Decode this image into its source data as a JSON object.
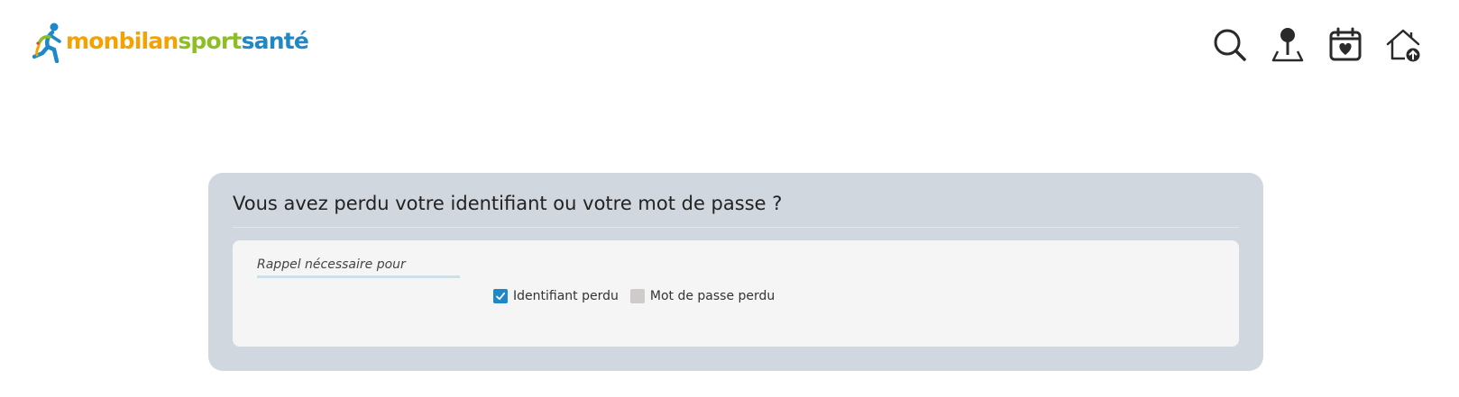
{
  "header": {
    "logo": {
      "part1": "monbilan",
      "part2": "sport",
      "part3": "santé"
    },
    "icons": [
      "search-icon",
      "location-pin-icon",
      "calendar-heart-icon",
      "home-upload-icon"
    ]
  },
  "form": {
    "title": "Vous avez perdu votre identifiant ou votre mot de passe ?",
    "field_label": "Rappel nécessaire pour",
    "options": [
      {
        "label": "Identifiant perdu",
        "checked": true
      },
      {
        "label": "Mot de passe perdu",
        "checked": false
      }
    ]
  },
  "colors": {
    "brand_orange": "#f5a200",
    "brand_green": "#8dbe22",
    "brand_blue": "#1e88c9",
    "panel_bg": "#d0d7de",
    "inner_bg": "#f5f5f5"
  }
}
